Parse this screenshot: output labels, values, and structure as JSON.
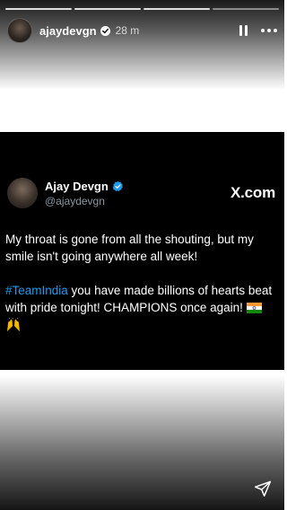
{
  "story": {
    "username": "ajaydevgn",
    "time": "28 m",
    "progress_segments": 4
  },
  "icons": {
    "verified": "verified-badge-icon",
    "pause": "pause-icon",
    "more": "more-options-icon",
    "send": "send-icon",
    "flag": "india-flag-icon",
    "hands": "raising-hands-icon"
  },
  "tweet": {
    "name": "Ajay Devgn",
    "handle": "@ajaydevgn",
    "site": "X.com",
    "line1": "My throat is gone from all the shouting, but my smile isn't going anywhere all week!",
    "hashtag": "#TeamIndia",
    "line2": " you have made billions of hearts beat with pride tonight! CHAMPIONS once again! "
  },
  "colors": {
    "card_bg": "#000000",
    "hashtag": "#1d9bf0",
    "verified": "#1d9bf0",
    "handle": "#8b98a5"
  }
}
